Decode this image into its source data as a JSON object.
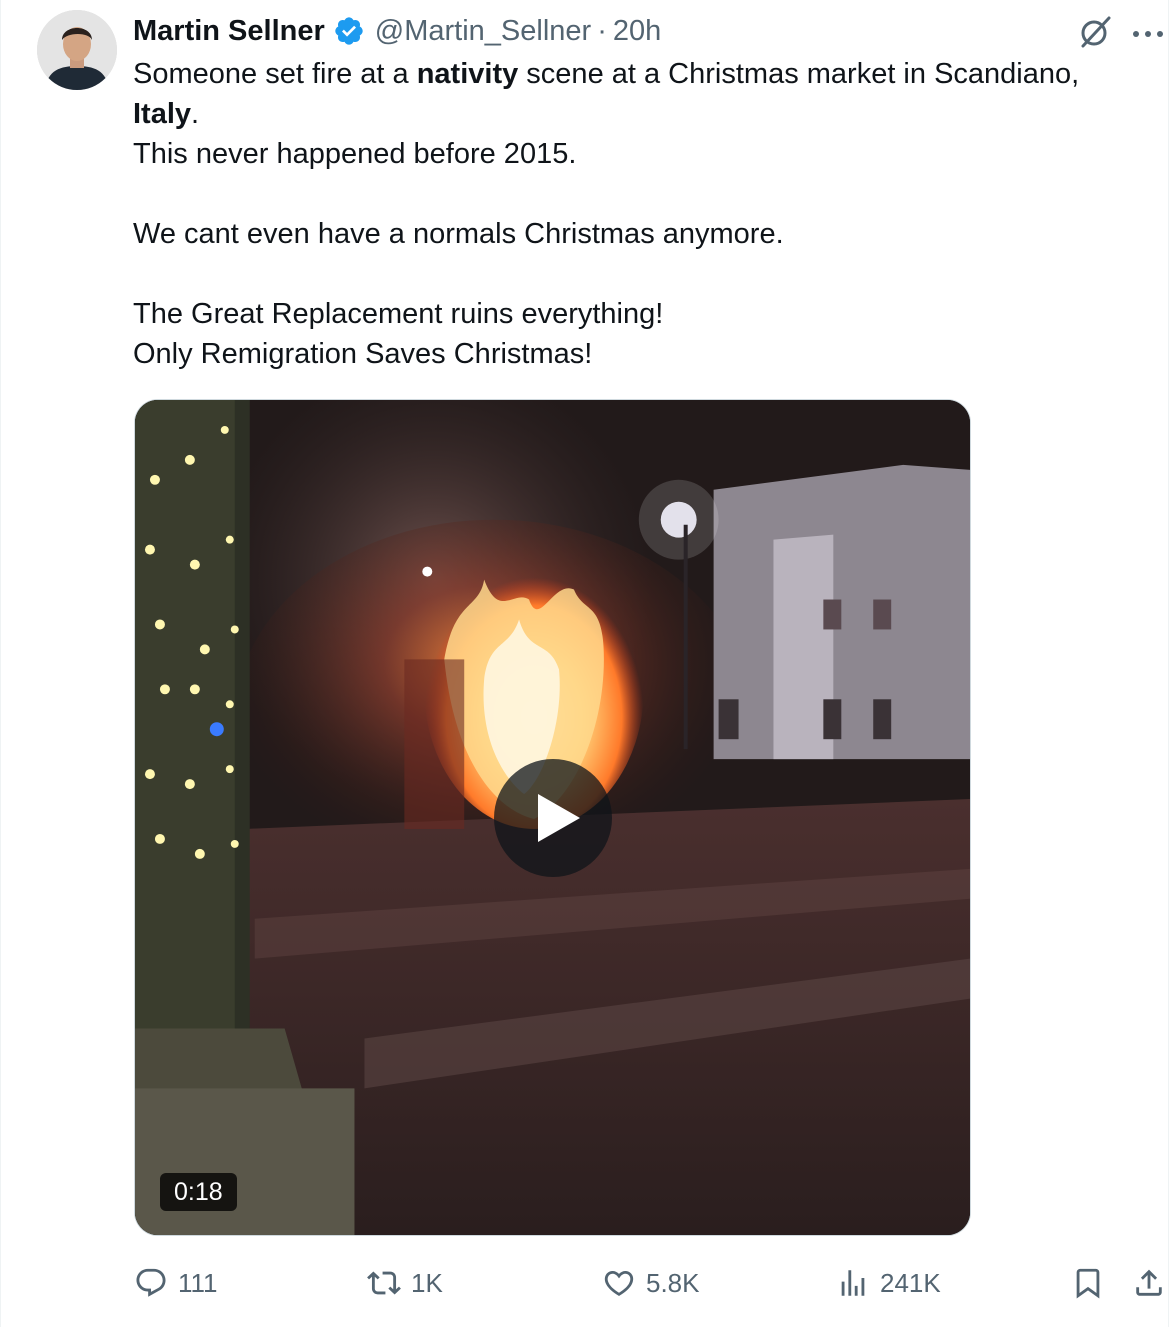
{
  "author": {
    "name": "Martin Sellner",
    "handle": "@Martin_Sellner",
    "separator": "·",
    "time": "20h",
    "verified_color": "#1d9bf0"
  },
  "post": {
    "line1_a": "Someone set fire at a ",
    "line1_b": "nativity",
    "line1_c": " scene at a Christmas market in Scandiano,",
    "line2_a": "Italy",
    "line2_b": ".",
    "line3": "This never happened before 2015.",
    "line5": "We cant even have a normals Christmas anymore.",
    "line7": "The Great Replacement ruins everything!",
    "line8": "Only Remigration Saves Christmas!"
  },
  "media": {
    "type": "video",
    "duration": "0:18"
  },
  "actions": {
    "replies": "111",
    "reposts": "1K",
    "likes": "5.8K",
    "views": "241K"
  },
  "icons": {
    "reply": "reply-icon",
    "repost": "repost-icon",
    "like": "heart-icon",
    "views": "views-icon",
    "bookmark": "bookmark-icon",
    "share": "share-icon",
    "grok": "grok-icon",
    "more": "more-icon",
    "play": "play-icon"
  },
  "colors": {
    "text": "#0f1419",
    "secondary": "#536471",
    "accent": "#1d9bf0"
  }
}
